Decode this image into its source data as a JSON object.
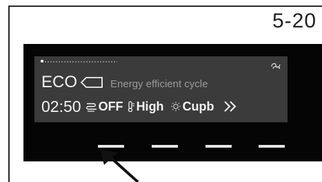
{
  "figure_label": "5-20",
  "display": {
    "program": "ECO",
    "program_description": "Energy efficient cycle",
    "time": "02:50",
    "options": [
      {
        "icon": "extra-dry-icon",
        "value": "OFF"
      },
      {
        "icon": "thermometer-icon",
        "value": "High"
      },
      {
        "icon": "sun-icon",
        "value": "Cupb"
      }
    ],
    "status_icon": "fan-icon",
    "next_icon": "double-chevron-right-icon"
  },
  "buttons": [
    {
      "name": "touch-button-1",
      "selected": true
    },
    {
      "name": "touch-button-2",
      "selected": false
    },
    {
      "name": "touch-button-3",
      "selected": false
    },
    {
      "name": "touch-button-4",
      "selected": false
    }
  ],
  "colors": {
    "panel": "#050505",
    "screen": "#3b3b3b",
    "text": "#f2f2f2",
    "muted_text": "#9a9a9a"
  }
}
